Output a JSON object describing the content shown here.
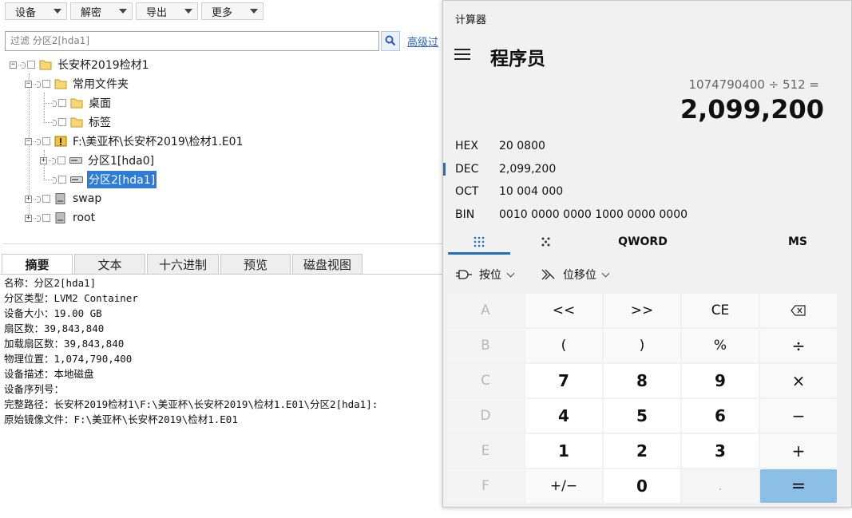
{
  "toolbar": {
    "device_label": "设备",
    "decrypt_label": "解密",
    "export_label": "导出",
    "more_label": "更多"
  },
  "filter": {
    "placeholder": "过滤 分区2[hda1]",
    "advanced_label": "高级过"
  },
  "tree": {
    "case": "长安杯2019检材1",
    "common_folders": "常用文件夹",
    "desktop": "桌面",
    "tags": "标签",
    "image": "F:\\美亚杯\\长安杯2019\\检材1.E01",
    "partition1": "分区1[hda0]",
    "partition2": "分区2[hda1]",
    "swap": "swap",
    "root": "root"
  },
  "tabs": [
    "摘要",
    "文本",
    "十六进制",
    "预览",
    "磁盘视图"
  ],
  "summary": [
    "名称：分区2[hda1]",
    "分区类型：LVM2 Container",
    "设备大小：19.00 GB",
    "扇区数：39,843,840",
    "加载扇区数：39,843,840",
    "物理位置：1,074,790,400",
    "设备描述：本地磁盘",
    "设备序列号：",
    "完整路径：长安杯2019检材1\\F:\\美亚杯\\长安杯2019\\检材1.E01\\分区2[hda1]:",
    "原始镜像文件：F:\\美亚杯\\长安杯2019\\检材1.E01"
  ],
  "calculator": {
    "window_title": "计算器",
    "mode_title": "程序员",
    "expression": "1074790400 ÷ 512 =",
    "result": "2,099,200",
    "radix": {
      "hex_label": "HEX",
      "hex_value": "20 0800",
      "dec_label": "DEC",
      "dec_value": "2,099,200",
      "oct_label": "OCT",
      "oct_value": "10 004 000",
      "bin_label": "BIN",
      "bin_value": "0010 0000 0000 1000 0000 0000"
    },
    "word_size": "QWORD",
    "memory": "MS",
    "bitwise_label": "按位",
    "bitshift_label": "位移位",
    "keys": {
      "A": "A",
      "lsh": "<<",
      "rsh": ">>",
      "CE": "CE",
      "B": "B",
      "lparen": "(",
      "rparen": ")",
      "mod": "%",
      "C": "C",
      "n7": "7",
      "n8": "8",
      "n9": "9",
      "D": "D",
      "n4": "4",
      "n5": "5",
      "n6": "6",
      "E": "E",
      "n1": "1",
      "n2": "2",
      "n3": "3",
      "F": "F",
      "negate": "+/−",
      "n0": "0",
      "dot": ".",
      "divide": "÷",
      "multiply": "×",
      "minus": "−",
      "plus": "+",
      "equals": "="
    },
    "accent_color": "#1a6fc9",
    "equals_color": "#8cbfe6"
  }
}
